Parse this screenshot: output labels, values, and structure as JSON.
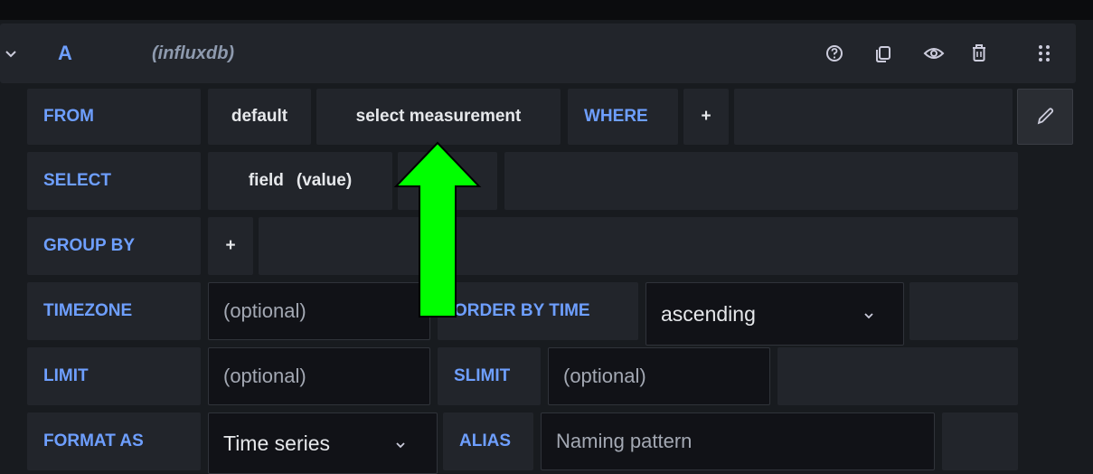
{
  "header": {
    "query_letter": "A",
    "datasource": "(influxdb)",
    "icons": [
      "help-icon",
      "duplicate-icon",
      "eye-icon",
      "trash-icon",
      "drag-handle-icon"
    ]
  },
  "rows": {
    "from": {
      "label": "FROM",
      "policy": "default",
      "measurement": "select measurement",
      "where_label": "WHERE",
      "add": "+"
    },
    "select": {
      "label": "SELECT",
      "field": "field",
      "value": "(value)",
      "add": "+"
    },
    "group_by": {
      "label": "GROUP BY",
      "add": "+"
    },
    "timezone": {
      "label": "TIMEZONE",
      "placeholder": "(optional)",
      "order_label": "ORDER BY TIME",
      "order_value": "ascending"
    },
    "limit": {
      "label": "LIMIT",
      "placeholder": "(optional)",
      "slimit_label": "SLIMIT",
      "slimit_placeholder": "(optional)"
    },
    "format": {
      "label": "FORMAT AS",
      "value": "Time series",
      "alias_label": "ALIAS",
      "alias_placeholder": "Naming pattern"
    }
  },
  "annotation": {
    "arrow_color": "#00ff00"
  },
  "colors": {
    "keyword": "#6e9fff",
    "background": "#181b1f",
    "cell": "#22252b",
    "input": "#111217"
  }
}
